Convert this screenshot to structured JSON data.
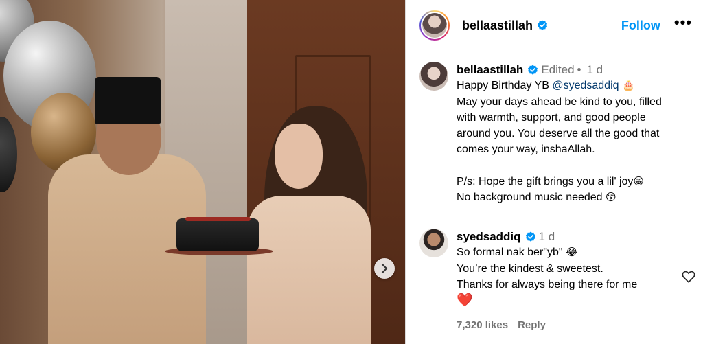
{
  "post": {
    "username": "bellaastillah",
    "follow_label": "Follow",
    "more_label": "•••"
  },
  "caption": {
    "username": "bellaastillah",
    "edited": "Edited",
    "separator": "•",
    "time": "1 d",
    "line1_prefix": "Happy Birthday YB ",
    "mention": "@syedsaddiq",
    "line1_emoji": "🎂",
    "lines": [
      "May your days ahead be kind to you, filled",
      "with warmth, support, and good people",
      "around you. You deserve all the good that",
      "comes your way, inshaAllah."
    ],
    "ps_line1": "P/s: Hope the gift brings you a lil' joy",
    "ps_line1_emoji": "😁",
    "ps_line2": "No background music needed ",
    "ps_line2_emoji": "😚"
  },
  "reply": {
    "username": "syedsaddiq",
    "time": "1 d",
    "line1": "So formal nak ber\"yb\" ",
    "line1_emoji": "😂",
    "line2": "You’re the kindest & sweetest.",
    "line3": "Thanks for always being there for me",
    "line4_emoji": "❤️",
    "likes": "7,320 likes",
    "reply_label": "Reply"
  },
  "colors": {
    "accent": "#0095f6",
    "verified": "#0095f6",
    "mention": "#00376b",
    "meta": "#737373"
  },
  "icons": {
    "verified": "verified-badge-icon",
    "carousel_next": "chevron-right-icon",
    "like": "heart-outline-icon"
  }
}
